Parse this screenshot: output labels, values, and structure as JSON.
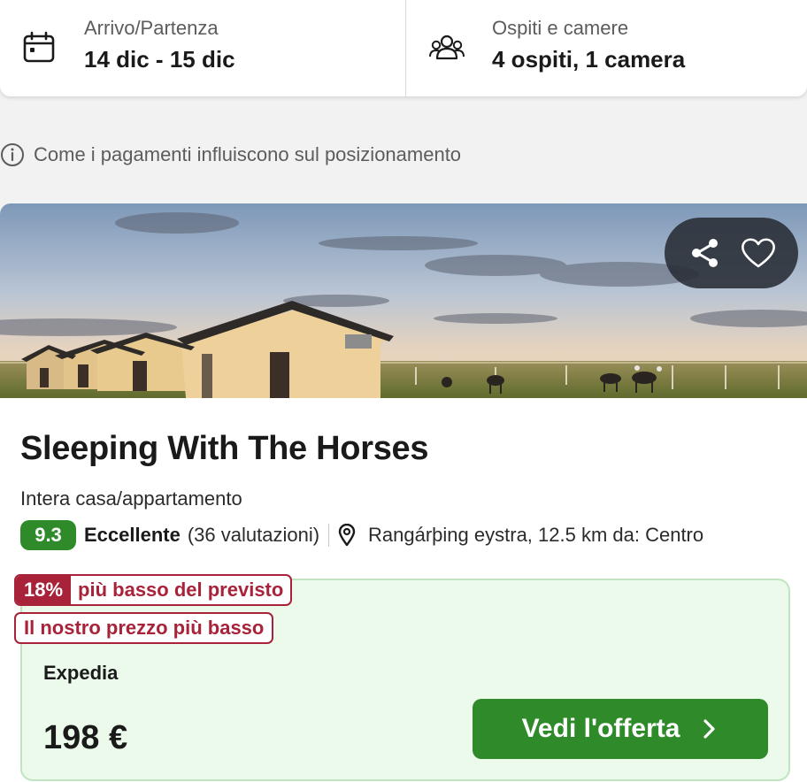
{
  "search": {
    "dates_label": "Arrivo/Partenza",
    "dates_value": "14 dic - 15 dic",
    "guests_label": "Ospiti e camere",
    "guests_value": "4 ospiti, 1 camera"
  },
  "info_line": "Come i pagamenti influiscono sul posizionamento",
  "hotel": {
    "name": "Sleeping With The Horses",
    "type": "Intera casa/appartamento",
    "score": "9.3",
    "rating_word": "Eccellente",
    "reviews": "(36 valutazioni)",
    "location": "Rangárþing eystra, 12.5 km da: Centro"
  },
  "deal": {
    "discount_pct": "18%",
    "discount_text": "più basso del previsto",
    "lowest_badge": "Il nostro prezzo più basso",
    "provider": "Expedia",
    "price": "198 €",
    "cta": "Vedi l'offerta"
  },
  "colors": {
    "accent_green": "#2f8a2a",
    "deal_red": "#a8233a",
    "deal_bg": "#ecfaec"
  },
  "icons": [
    "calendar-icon",
    "users-icon",
    "info-icon",
    "share-icon",
    "heart-icon",
    "map-pin-icon",
    "chevron-right-icon"
  ]
}
